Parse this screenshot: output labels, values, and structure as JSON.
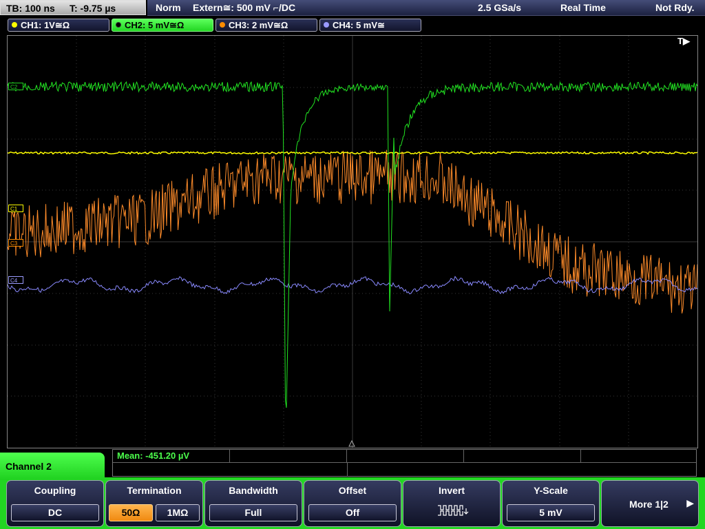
{
  "status": {
    "timebase": "TB: 100 ns",
    "trigger_time": "T: -9.75 µs",
    "trigger_mode": "Norm",
    "trigger_source": "Extern≅: 500 mV ⌐/DC",
    "sample_rate": "2.5 GSa/s",
    "acq_mode": "Real Time",
    "state": "Not Rdy."
  },
  "channels": [
    {
      "label": "CH1: 1V≅Ω",
      "color": "#ffff00"
    },
    {
      "label": "CH2: 5 mV≅Ω",
      "color": "#22d622"
    },
    {
      "label": "CH3: 2 mV≅Ω",
      "color": "#ff8c00"
    },
    {
      "label": "CH4: 5 mV≅",
      "color": "#9a9aff"
    }
  ],
  "trigger_indicator": "T▶",
  "markers": {
    "c1": "C1",
    "c3": "C3",
    "c4": "C4",
    "c2": "C2"
  },
  "measurement": {
    "label": "Mean: -451.20 µV"
  },
  "menu": {
    "title": "Channel 2",
    "coupling": {
      "title": "Coupling",
      "value": "DC"
    },
    "termination": {
      "title": "Termination",
      "opt1": "50Ω",
      "opt2": "1MΩ"
    },
    "bandwidth": {
      "title": "Bandwidth",
      "value": "Full"
    },
    "offset": {
      "title": "Offset",
      "value": "Off"
    },
    "invert": {
      "title": "Invert"
    },
    "yscale": {
      "title": "Y-Scale",
      "value": "5 mV"
    },
    "more": {
      "label": "More 1|2"
    }
  }
}
